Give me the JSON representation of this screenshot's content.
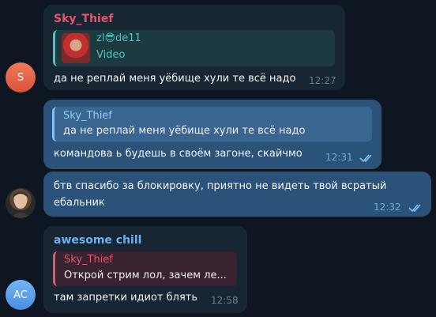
{
  "messages": [
    {
      "sender": "Sky_Thief",
      "avatar_initial": "S",
      "reply": {
        "name_part1": "zl",
        "emoji": "😎",
        "name_part2": "de11",
        "text": "Video"
      },
      "text": "да не реплай меня уёбище хули те всё надо",
      "time": "12:27"
    },
    {
      "reply": {
        "name": "Sky_Thief",
        "text": "да не реплай меня уёбище хули те всё надо"
      },
      "text": "командова ь будешь в своём загоне, скайчмо",
      "time": "12:31"
    },
    {
      "line1": "бтв спасибо за блокировку, приятно не видеть твой всратый",
      "line2": "ебальник",
      "time": "12:32"
    },
    {
      "sender": "awesome chill",
      "avatar_initial": "AC",
      "reply": {
        "name": "Sky_Thief",
        "text": "Открой стрим лол, зачем ле..."
      },
      "text": "там запретки идиот блять",
      "time": "12:58"
    }
  ],
  "colors": {
    "background": "#0e1621",
    "incoming": "#182533",
    "outgoing": "#2b5278",
    "sky_thief": "#e5566d",
    "awesome_chill": "#6ab2f2",
    "zl_de11": "#4fc3c0"
  },
  "icons": [
    "double-check-icon",
    "sunglasses-emoji-icon"
  ]
}
